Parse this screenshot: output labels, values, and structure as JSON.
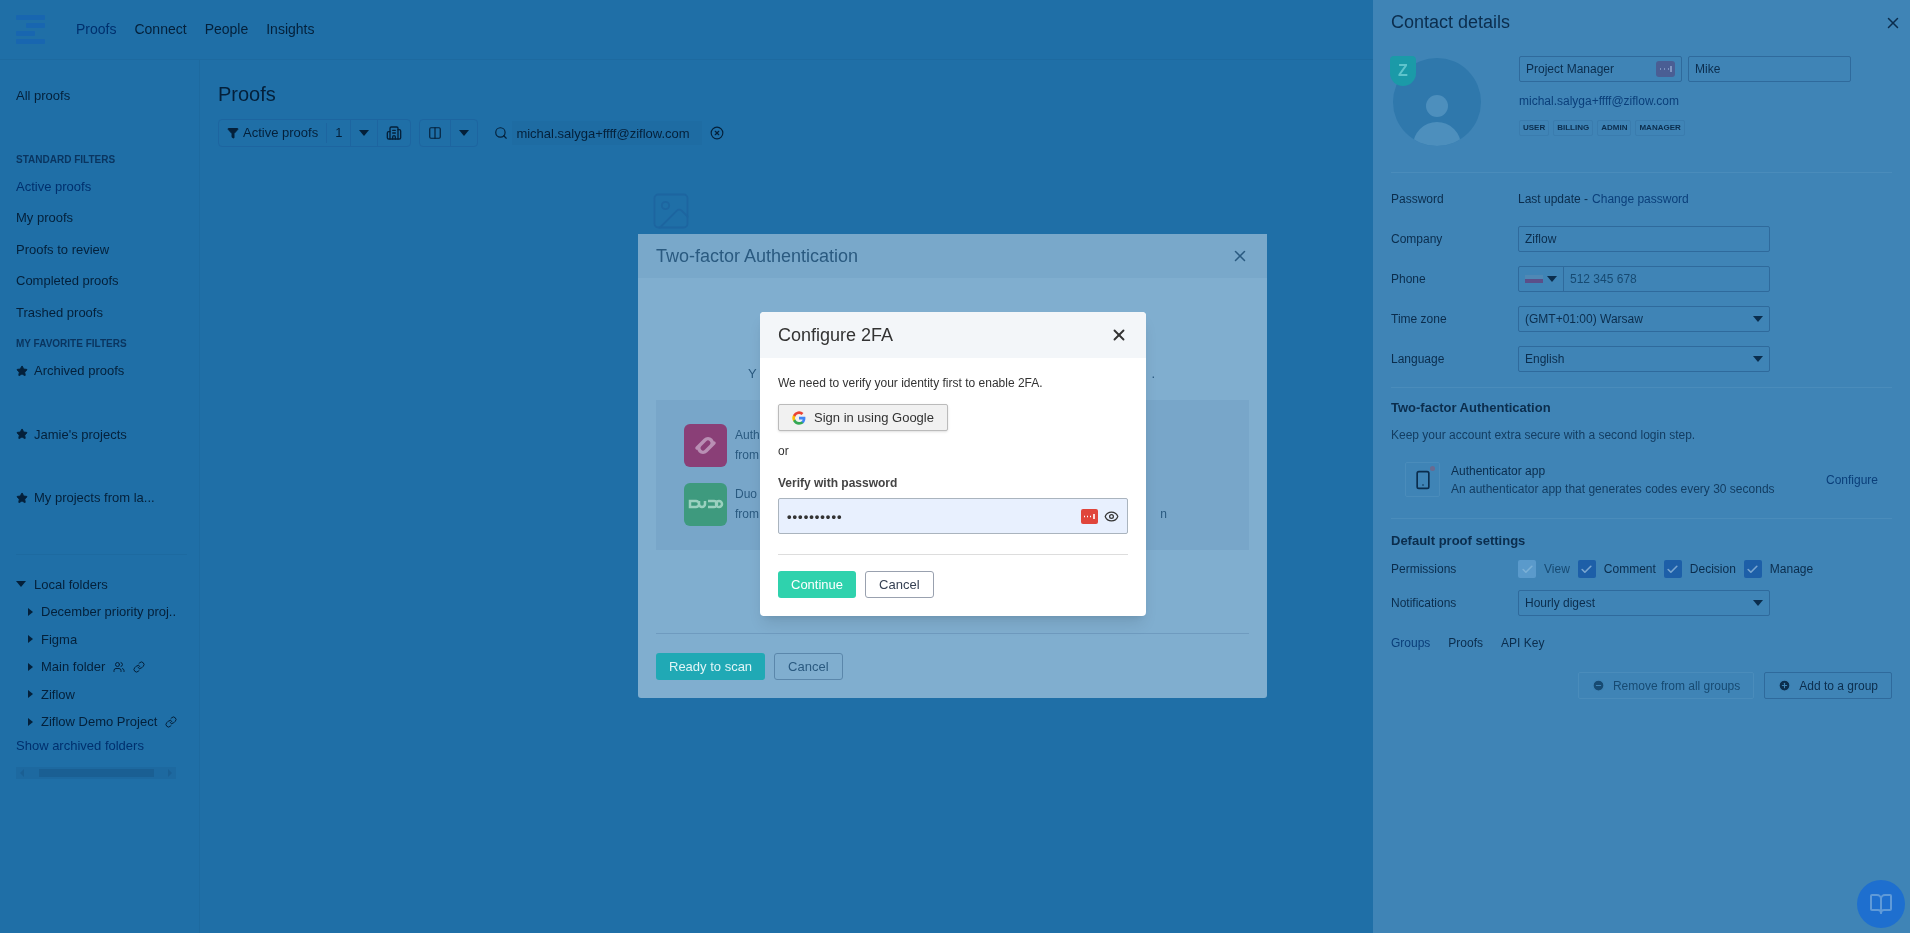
{
  "nav": {
    "items": [
      {
        "label": "Proofs",
        "selected": true
      },
      {
        "label": "Connect",
        "selected": false
      },
      {
        "label": "People",
        "selected": false
      },
      {
        "label": "Insights",
        "selected": false
      }
    ]
  },
  "sidebar": {
    "items": [
      {
        "kind": "link",
        "label": "All proofs",
        "selected": false
      },
      {
        "kind": "heading",
        "label": "STANDARD FILTERS"
      },
      {
        "kind": "link",
        "label": "Active proofs",
        "selected": true
      },
      {
        "kind": "link",
        "label": "My proofs",
        "selected": false
      },
      {
        "kind": "link",
        "label": "Proofs to review",
        "selected": false
      },
      {
        "kind": "link",
        "label": "Completed proofs",
        "selected": false
      },
      {
        "kind": "link",
        "label": "Trashed proofs",
        "selected": false
      },
      {
        "kind": "heading",
        "label": "MY FAVORITE FILTERS"
      },
      {
        "kind": "favorite",
        "label": "Archived proofs"
      },
      {
        "kind": "favorite",
        "label": "Jamie's projects"
      },
      {
        "kind": "favorite",
        "label": "My projects from la..."
      },
      {
        "kind": "folders",
        "label": "Local folders",
        "expanded": true,
        "children": [
          {
            "label": "December priority proj..",
            "shared": false,
            "linked": false
          },
          {
            "label": "Figma",
            "shared": false,
            "linked": false
          },
          {
            "label": "Main folder",
            "shared": true,
            "linked": true
          },
          {
            "label": "Ziflow",
            "shared": false,
            "linked": false
          },
          {
            "label": "Ziflow Demo Project",
            "shared": false,
            "linked": true
          }
        ]
      },
      {
        "kind": "action",
        "label": "Show archived folders"
      }
    ]
  },
  "main": {
    "title": "Proofs",
    "filter": {
      "label": "Active proofs",
      "count": "1"
    },
    "search": {
      "value": "michal.salyga+ffff@ziflow.com"
    }
  },
  "two_factor_dialog": {
    "title": "Two-factor Authentication",
    "intro_left": "Y",
    "intro_right": ".",
    "methods": [
      {
        "kind": "authy",
        "title": "Auth",
        "subtitle": "from"
      },
      {
        "kind": "duo",
        "title": "Duo",
        "subtitle": "from",
        "right": "n"
      }
    ],
    "buttons": [
      {
        "label": "Ready to scan",
        "kind": "primary"
      },
      {
        "label": "Cancel",
        "kind": "secondary"
      }
    ]
  },
  "configure_dialog": {
    "title": "Configure 2FA",
    "message": "We need to verify your identity first to enable 2FA.",
    "google_button": "Sign in using Google",
    "separator": "or",
    "password_label": "Verify with password",
    "password_value": "••••••••••",
    "buttons": [
      {
        "label": "Continue",
        "kind": "primary"
      },
      {
        "label": "Cancel",
        "kind": "secondary"
      }
    ]
  },
  "contact_details": {
    "title": "Contact details",
    "badge": "Z",
    "role": "Project Manager",
    "name": "Mike",
    "email": "michal.salyga+ffff@ziflow.com",
    "tags": [
      "USER",
      "BILLING",
      "ADMIN",
      "MANAGER"
    ],
    "rows": [
      {
        "kind": "password",
        "label": "Password",
        "text": "Last update -",
        "link": "Change password"
      },
      {
        "kind": "input",
        "label": "Company",
        "value": "Ziflow"
      },
      {
        "kind": "phone",
        "label": "Phone",
        "placeholder": "512 345 678"
      },
      {
        "kind": "select",
        "label": "Time zone",
        "value": "(GMT+01:00) Warsaw"
      },
      {
        "kind": "select",
        "label": "Language",
        "value": "English"
      }
    ],
    "two_factor": {
      "title": "Two-factor Authentication",
      "description": "Keep your account extra secure with a second login step.",
      "app_title": "Authenticator app",
      "app_description": "An authenticator app that generates codes every 30 seconds",
      "action": "Configure"
    },
    "proof_settings": {
      "title": "Default proof settings",
      "permissions_label": "Permissions",
      "permissions": [
        {
          "label": "View",
          "checked": true,
          "disabled": true
        },
        {
          "label": "Comment",
          "checked": true,
          "disabled": false
        },
        {
          "label": "Decision",
          "checked": true,
          "disabled": false
        },
        {
          "label": "Manage",
          "checked": true,
          "disabled": false
        }
      ],
      "notifications_label": "Notifications",
      "notifications_value": "Hourly digest"
    },
    "tabs": [
      {
        "label": "Groups",
        "selected": true
      },
      {
        "label": "Proofs",
        "selected": false
      },
      {
        "label": "API Key",
        "selected": false
      }
    ],
    "buttons": [
      {
        "label": "Remove from all groups",
        "kind": "remove",
        "disabled": true
      },
      {
        "label": "Add to a group",
        "kind": "add",
        "disabled": false
      }
    ]
  }
}
